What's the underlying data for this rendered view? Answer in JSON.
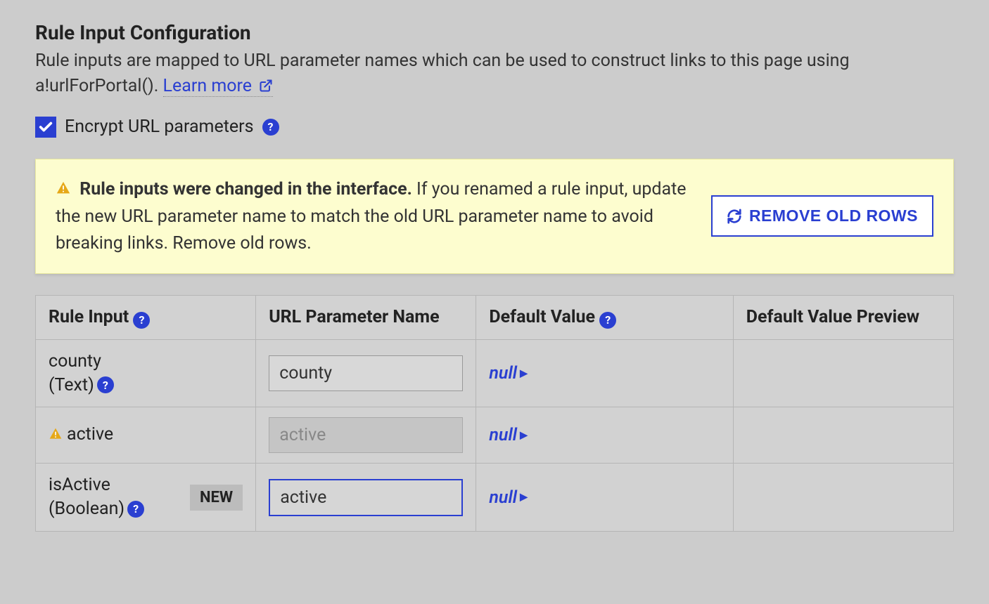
{
  "header": {
    "title": "Rule Input Configuration",
    "description_pre": "Rule inputs are mapped to URL parameter names which can be used to construct links to this page using a!urlForPortal(). ",
    "learn_more": "Learn more"
  },
  "checkbox": {
    "label": "Encrypt URL parameters",
    "checked": true
  },
  "banner": {
    "strong": "Rule inputs were changed in the interface.",
    "rest": " If you renamed a rule input, update the new URL parameter name to match the old URL parameter name to avoid breaking links. Remove old rows.",
    "button": "REMOVE OLD ROWS"
  },
  "table": {
    "headers": {
      "rule_input": "Rule Input",
      "url_param": "URL Parameter Name",
      "default_value": "Default Value",
      "default_preview": "Default Value Preview"
    },
    "rows": [
      {
        "name": "county",
        "type": "(Text)",
        "help": true,
        "warn": false,
        "new": false,
        "url_param": "county",
        "url_param_disabled": false,
        "url_param_active": false,
        "default_value": "null",
        "default_preview": ""
      },
      {
        "name": "active",
        "type": "",
        "help": false,
        "warn": true,
        "new": false,
        "url_param": "active",
        "url_param_disabled": true,
        "url_param_active": false,
        "default_value": "null",
        "default_preview": ""
      },
      {
        "name": "isActive",
        "type": "(Boolean)",
        "help": true,
        "warn": false,
        "new": true,
        "url_param": "active",
        "url_param_disabled": false,
        "url_param_active": true,
        "default_value": "null",
        "default_preview": ""
      }
    ]
  },
  "labels": {
    "new_badge": "NEW"
  }
}
